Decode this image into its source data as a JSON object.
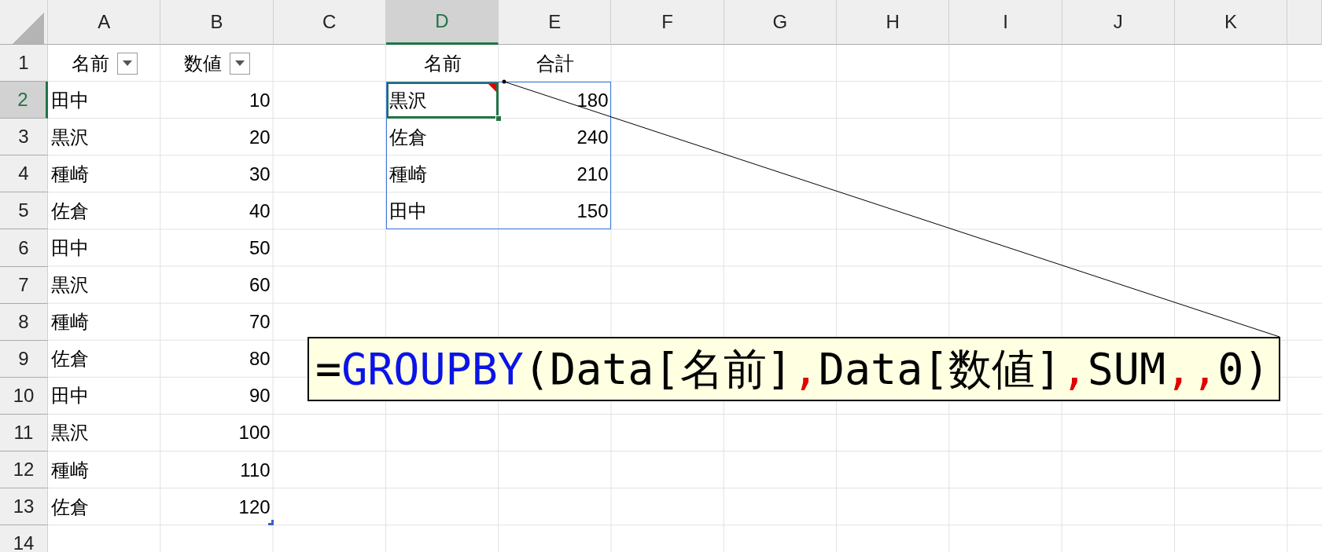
{
  "column_headers": [
    {
      "label": "A",
      "selected": false
    },
    {
      "label": "B",
      "selected": false
    },
    {
      "label": "C",
      "selected": false
    },
    {
      "label": "D",
      "selected": true
    },
    {
      "label": "E",
      "selected": false
    },
    {
      "label": "F",
      "selected": false
    },
    {
      "label": "G",
      "selected": false
    },
    {
      "label": "H",
      "selected": false
    },
    {
      "label": "I",
      "selected": false
    },
    {
      "label": "J",
      "selected": false
    },
    {
      "label": "K",
      "selected": false
    }
  ],
  "row_headers": [
    {
      "label": "1",
      "selected": false
    },
    {
      "label": "2",
      "selected": true
    },
    {
      "label": "3",
      "selected": false
    },
    {
      "label": "4",
      "selected": false
    },
    {
      "label": "5",
      "selected": false
    },
    {
      "label": "6",
      "selected": false
    },
    {
      "label": "7",
      "selected": false
    },
    {
      "label": "8",
      "selected": false
    },
    {
      "label": "9",
      "selected": false
    },
    {
      "label": "10",
      "selected": false
    },
    {
      "label": "11",
      "selected": false
    },
    {
      "label": "12",
      "selected": false
    },
    {
      "label": "13",
      "selected": false
    },
    {
      "label": "14",
      "selected": false
    }
  ],
  "source_table": {
    "columns": [
      {
        "label": "名前",
        "filter_button": true
      },
      {
        "label": "数値",
        "filter_button": true
      }
    ],
    "rows": [
      [
        "田中",
        "10"
      ],
      [
        "黒沢",
        "20"
      ],
      [
        "種崎",
        "30"
      ],
      [
        "佐倉",
        "40"
      ],
      [
        "田中",
        "50"
      ],
      [
        "黒沢",
        "60"
      ],
      [
        "種崎",
        "70"
      ],
      [
        "佐倉",
        "80"
      ],
      [
        "田中",
        "90"
      ],
      [
        "黒沢",
        "100"
      ],
      [
        "種崎",
        "110"
      ],
      [
        "佐倉",
        "120"
      ]
    ]
  },
  "result_table": {
    "columns": [
      "名前",
      "合計"
    ],
    "rows": [
      {
        "name": "黒沢",
        "total": "180",
        "selected": true,
        "comment": true
      },
      {
        "name": "佐倉",
        "total": "240",
        "selected": false,
        "comment": false
      },
      {
        "name": "種崎",
        "total": "210",
        "selected": false,
        "comment": false
      },
      {
        "name": "田中",
        "total": "150",
        "selected": false,
        "comment": false
      }
    ]
  },
  "formula_callout": {
    "tokens": [
      {
        "text": "=",
        "kind": "plain"
      },
      {
        "text": "GROUPBY",
        "kind": "function"
      },
      {
        "text": "(Data[名前]",
        "kind": "plain"
      },
      {
        "text": ",",
        "kind": "separator"
      },
      {
        "text": "Data[数値]",
        "kind": "plain"
      },
      {
        "text": ",",
        "kind": "separator"
      },
      {
        "text": "SUM",
        "kind": "plain"
      },
      {
        "text": ",",
        "kind": "separator"
      },
      {
        "text": ",",
        "kind": "separator"
      },
      {
        "text": "0)",
        "kind": "plain"
      }
    ]
  }
}
